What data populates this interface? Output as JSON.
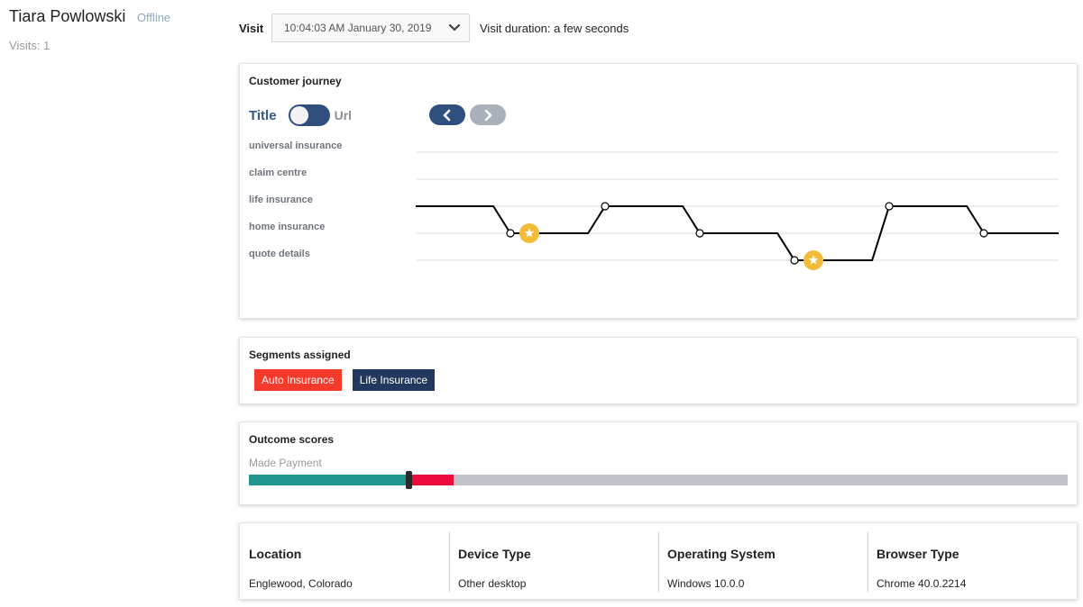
{
  "profile": {
    "name": "Tiara Powlowski",
    "status": "Offline",
    "visits": "Visits: 1"
  },
  "visit": {
    "label": "Visit",
    "selected": "10:04:03 AM January 30, 2019",
    "duration": "Visit duration: a few seconds"
  },
  "journey": {
    "title": "Customer journey",
    "toggle_left": "Title",
    "toggle_right": "Url",
    "toggle_state": "off",
    "pages": [
      "universal insurance",
      "claim centre",
      "life insurance",
      "home insurance",
      "quote details"
    ],
    "path": [
      {
        "page": "life insurance",
        "marker": "none"
      },
      {
        "page": "home insurance",
        "marker": "star"
      },
      {
        "page": "life insurance",
        "marker": "dot"
      },
      {
        "page": "home insurance",
        "marker": "dot"
      },
      {
        "page": "quote details",
        "marker": "star"
      },
      {
        "page": "life insurance",
        "marker": "dot"
      },
      {
        "page": "home insurance",
        "marker": "dot"
      }
    ],
    "colors": {
      "line": "#000000",
      "star": "#f2bc3a",
      "grid": "#dcdcdc"
    }
  },
  "segments": {
    "title": "Segments assigned",
    "items": [
      {
        "label": "Auto Insurance",
        "color": "#f43b2b"
      },
      {
        "label": "Life Insurance",
        "color": "#23385f"
      }
    ]
  },
  "outcome": {
    "title": "Outcome scores",
    "label": "Made Payment",
    "score_fraction": 0.195,
    "upper_fraction": 0.25,
    "colors": {
      "low": "#20968e",
      "range": "#ec0c3b",
      "rest": "#c3c4ca"
    }
  },
  "info": [
    {
      "heading": "Location",
      "value": "Englewood, Colorado"
    },
    {
      "heading": "Device Type",
      "value": "Other desktop"
    },
    {
      "heading": "Operating System",
      "value": "Windows 10.0.0"
    },
    {
      "heading": "Browser Type",
      "value": "Chrome 40.0.2214"
    }
  ]
}
